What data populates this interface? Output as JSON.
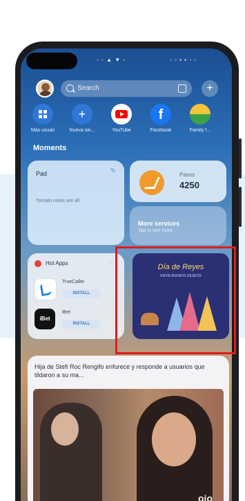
{
  "status": {
    "left": "◦ ◦ ▲ ▼ ◦",
    "right": "◦ ◦ ▪ ▪ ◦ ◦"
  },
  "search": {
    "placeholder": "Search"
  },
  "apps": [
    {
      "label": "Más usuari",
      "icon": "grid-icon",
      "color": "#2f77d6"
    },
    {
      "label": "Nueva sin...",
      "icon": "plus-icon",
      "color": "#2f77d6"
    },
    {
      "label": "YouTube",
      "icon": "youtube-icon",
      "color": "#ffffff"
    },
    {
      "label": "Facebook",
      "icon": "facebook-icon",
      "color": "#1877f2"
    },
    {
      "label": "Family f...",
      "icon": "family-icon",
      "color": "#f1c43a"
    }
  ],
  "moments": {
    "title": "Moments"
  },
  "notes_card": {
    "title": "Pad",
    "body": "Tomato notes are all"
  },
  "fitness_card": {
    "label": "Pasos",
    "value": "4250"
  },
  "more_card": {
    "title": "More services",
    "subtitle": "Tap to see more"
  },
  "hot_apps": {
    "title": "Hot Apps",
    "items": [
      {
        "name": "TrueCaller",
        "button": "INSTALL",
        "color": "#1e88e5"
      },
      {
        "name": "iBet",
        "button": "INSTALL",
        "color": "#111111"
      }
    ]
  },
  "promo": {
    "title": "Día de Reyes",
    "subtitle": "ENVÍA BUENOS DESEOS"
  },
  "news": {
    "headline": "Hija de Stefi Roc Rengifo enfurece y responde a usuarios que tildaron a su ma...",
    "watermark": "ojo"
  },
  "colors": {
    "accent": "#2f77d6",
    "highlight": "#e21b1b"
  }
}
